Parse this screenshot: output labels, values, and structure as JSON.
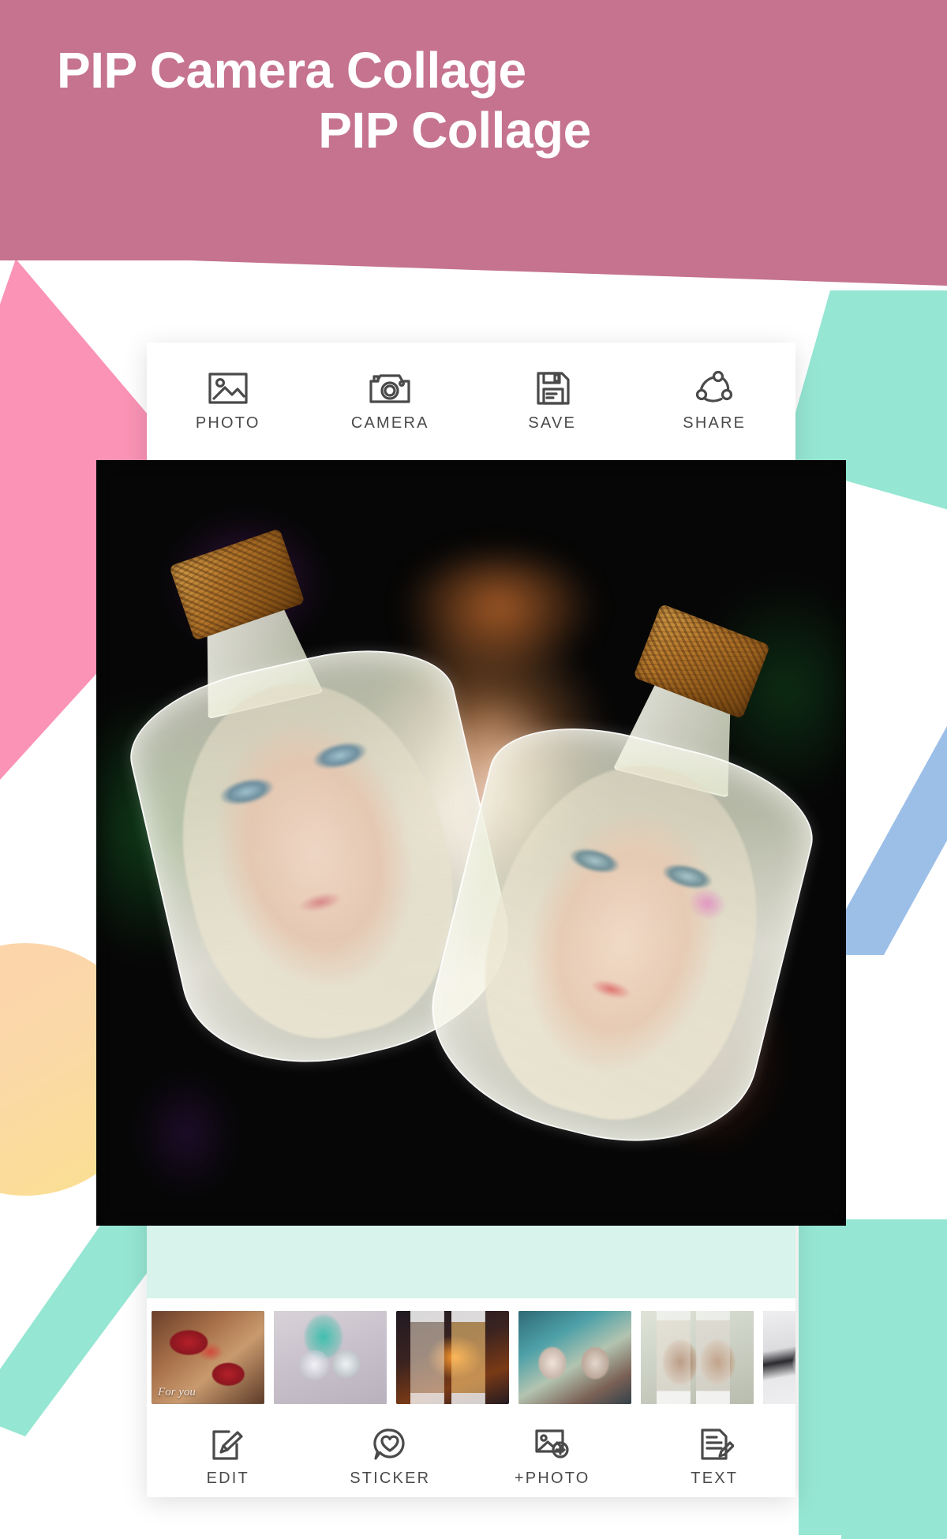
{
  "promo": {
    "title_line_1": "PIP Camera Collage",
    "title_line_2": "PIP Collage"
  },
  "theme": {
    "brand_pink": "#c5738f",
    "accent_pink": "#fa93b5",
    "accent_mint": "#95e6d3",
    "accent_mint_pale": "#d7f3ec",
    "accent_blue": "#9cbfe8",
    "accent_orange": "#fbd9a4",
    "icon_color": "#4a4a4a",
    "canvas_bg": "#050505"
  },
  "top_toolbar": {
    "items": [
      {
        "label": "PHOTO",
        "icon": "photo-icon"
      },
      {
        "label": "CAMERA",
        "icon": "camera-icon"
      },
      {
        "label": "SAVE",
        "icon": "floppy-disk-icon"
      },
      {
        "label": "SHARE",
        "icon": "share-nodes-icon"
      }
    ]
  },
  "bottom_toolbar": {
    "items": [
      {
        "label": "EDIT",
        "icon": "pencil-frame-icon"
      },
      {
        "label": "STICKER",
        "icon": "heart-bubble-icon"
      },
      {
        "label": "+PHOTO",
        "icon": "photo-plus-icon"
      },
      {
        "label": "TEXT",
        "icon": "document-pencil-icon"
      }
    ]
  },
  "canvas": {
    "description": "Two cork-stoppered glass bottles, each framing a woman's portrait, over a dark blurred bokeh background",
    "frames": [
      {
        "name": "bottle-left",
        "subject": "blonde woman portrait"
      },
      {
        "name": "bottle-right",
        "subject": "blonde woman portrait with pink flower"
      }
    ]
  },
  "thumbnails": [
    {
      "name": "template-hearts",
      "caption": "For you"
    },
    {
      "name": "template-snow-globes",
      "caption": ""
    },
    {
      "name": "template-milk-bottles",
      "caption": ""
    },
    {
      "name": "template-pendants",
      "caption": ""
    },
    {
      "name": "template-tumblers",
      "caption": ""
    },
    {
      "name": "template-partial",
      "caption": ""
    }
  ]
}
